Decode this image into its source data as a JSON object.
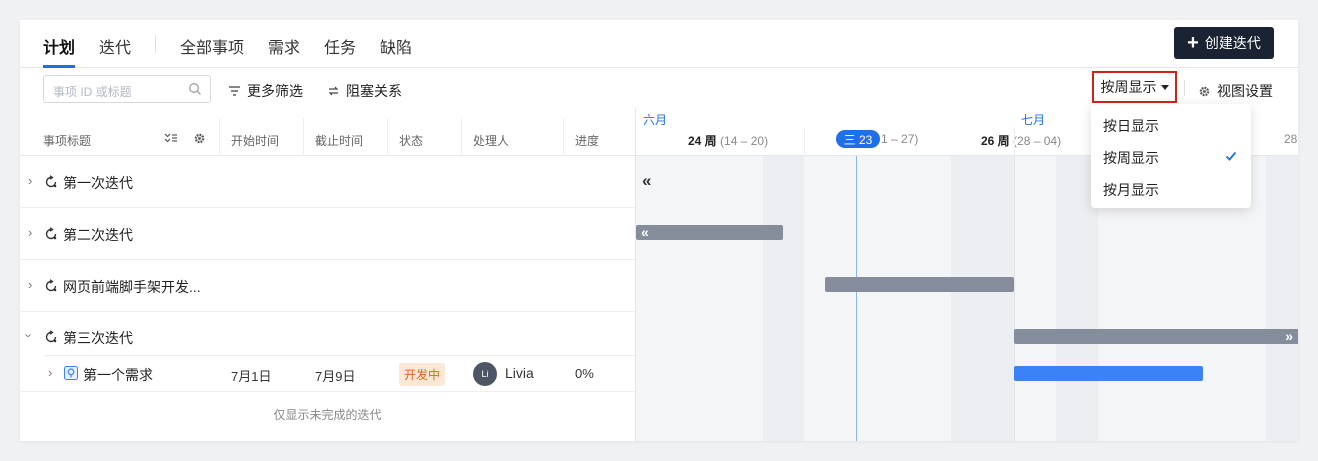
{
  "nav": {
    "tabs": [
      {
        "label": "计划",
        "active": true
      },
      {
        "label": "迭代",
        "active": false
      },
      {
        "label": "全部事项",
        "active": false
      },
      {
        "label": "需求",
        "active": false
      },
      {
        "label": "任务",
        "active": false
      },
      {
        "label": "缺陷",
        "active": false
      }
    ],
    "create_button": "创建迭代"
  },
  "toolbar": {
    "search_placeholder": "事项 ID 或标题",
    "more_filters": "更多筛选",
    "blocking": "阻塞关系",
    "view_mode": "按周显示",
    "view_settings": "视图设置"
  },
  "table": {
    "columns": [
      "事项标题",
      "开始时间",
      "截止时间",
      "状态",
      "处理人",
      "进度"
    ],
    "rows": [
      {
        "title": "第一次迭代",
        "expanded": false
      },
      {
        "title": "第二次迭代",
        "expanded": false
      },
      {
        "title": "网页前端脚手架开发...",
        "expanded": false
      },
      {
        "title": "第三次迭代",
        "expanded": true
      }
    ],
    "child_row": {
      "title": "第一个需求",
      "start": "7月1日",
      "end": "7月9日",
      "status": "开发中",
      "assignee_initials": "Li",
      "assignee": "Livia",
      "progress": "0%"
    },
    "footer_note": "仅显示未完成的迭代"
  },
  "gantt": {
    "months": [
      "六月",
      "七月"
    ],
    "weeks": [
      {
        "label": "24 周",
        "range": "(14 – 20)"
      },
      {
        "label": "",
        "range": "1 – 27)"
      },
      {
        "label": "26 周",
        "range": "(28 – 04)"
      },
      {
        "label": "28",
        "range": ""
      }
    ],
    "today": "三 23",
    "collapse_marker": "«",
    "expand_marker": "»"
  },
  "dropdown": {
    "options": [
      "按日显示",
      "按周显示",
      "按月显示"
    ],
    "selected": "按周显示"
  },
  "colors": {
    "accent": "#1f6fe8",
    "bar_gray": "#858c9b",
    "bar_blue": "#3b82f6",
    "status_orange": "#e0641b",
    "highlight_border": "#d2231a"
  }
}
